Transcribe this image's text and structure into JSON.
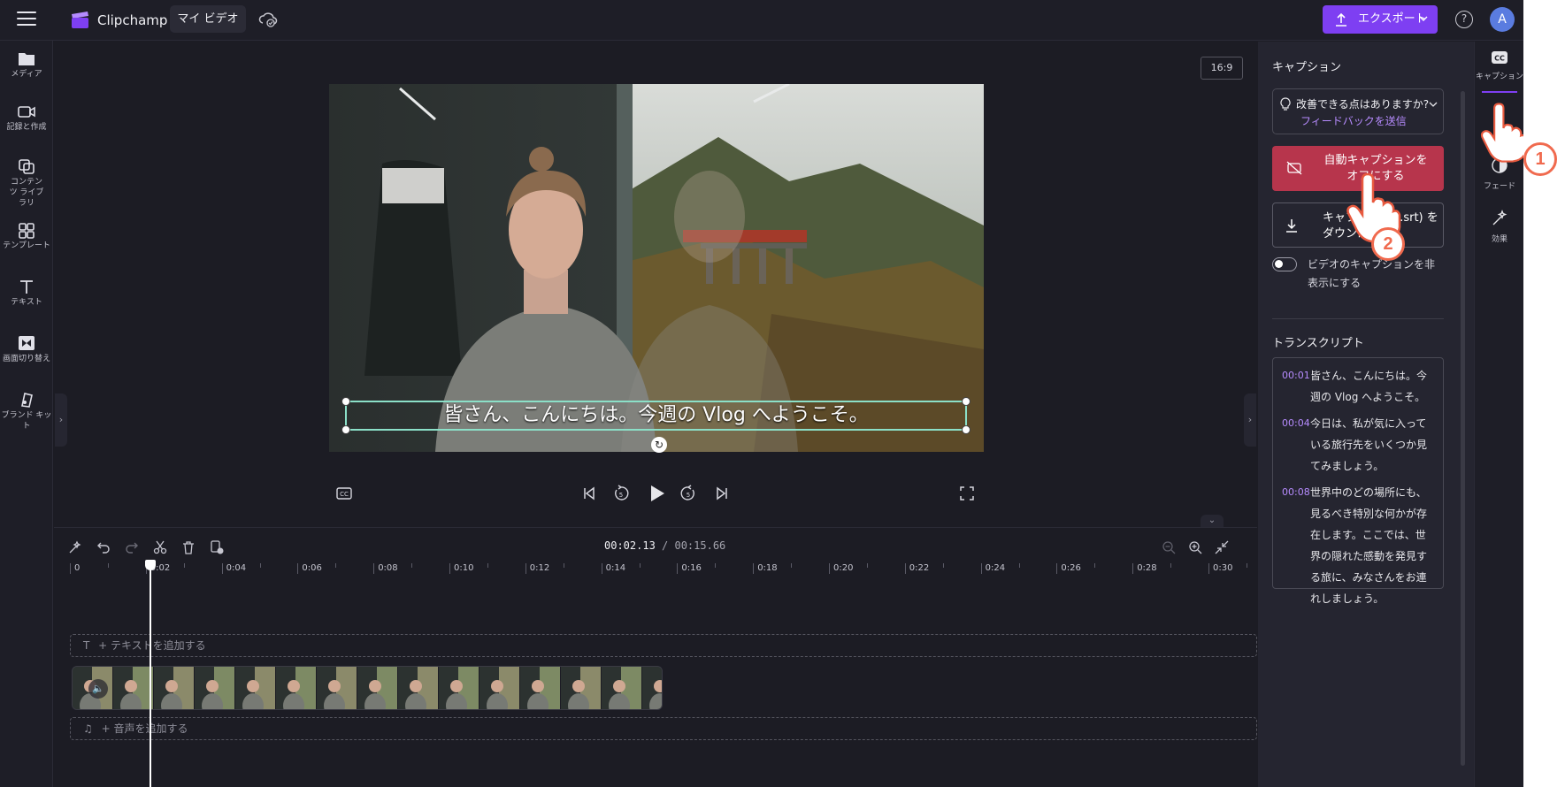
{
  "topbar": {
    "brand": "Clipchamp",
    "my_video": "マイ ビデオ",
    "export_label": "エクスポート",
    "avatar_initial": "A",
    "help_glyph": "?"
  },
  "sidebar": {
    "items": [
      {
        "label": "メディア",
        "icon": "folder-icon"
      },
      {
        "label": "記録と作成",
        "icon": "camera-icon"
      },
      {
        "label": "コンテンツ ライブラリ",
        "icon": "library-icon"
      },
      {
        "label": "テンプレート",
        "icon": "template-icon"
      },
      {
        "label": "テキスト",
        "icon": "text-icon"
      },
      {
        "label": "画面切り替え",
        "icon": "transition-icon"
      },
      {
        "label": "ブランド キット",
        "icon": "brand-icon"
      }
    ]
  },
  "preview": {
    "aspect_ratio": "16:9",
    "caption": "皆さん、こんにちは。今週の Vlog へようこそ。"
  },
  "timeline": {
    "current_time": "00:02.13",
    "separator": " / ",
    "duration": "00:15.66",
    "ticks": [
      "0",
      "0:02",
      "0:04",
      "0:06",
      "0:08",
      "0:10",
      "0:12",
      "0:14",
      "0:16",
      "0:18",
      "0:20",
      "0:22",
      "0:24",
      "0:26",
      "0:28",
      "0:30"
    ],
    "add_text": "+ テキストを追加する",
    "add_audio": "+ 音声を追加する"
  },
  "captions_panel": {
    "title": "キャプション",
    "feedback_question": "改善できる点はありますか?",
    "feedback_link": "フィードバックを送信",
    "auto_caption_off": "自動キャプションを オフにする",
    "download_srt": "キャプション (.srt) をダウンロード",
    "hide_captions": "ビデオのキャプションを非表示にする",
    "transcript_title": "トランスクリプト",
    "transcript": [
      {
        "time": "00:01",
        "text": "皆さん、こんにちは。今週の Vlog へようこそ。"
      },
      {
        "time": "00:04",
        "text": "今日は、私が気に入っている旅行先をいくつか見てみましょう。"
      },
      {
        "time": "00:08",
        "text": "世界中のどの場所にも、見るべき特別な何かが存在します。ここでは、世界の隠れた感動を発見する旅に、みなさんをお連れしましょう。"
      }
    ]
  },
  "right_tools": [
    {
      "label": "キャプション",
      "icon": "cc-icon"
    },
    {
      "label": "フェード",
      "icon": "fade-icon"
    },
    {
      "label": "効果",
      "icon": "effects-icon"
    }
  ],
  "annotations": {
    "step1": "1",
    "step2": "2"
  },
  "colors": {
    "accent": "#7e3ff2",
    "caption_off": "#b7354c",
    "timestamp": "#b78cff",
    "step_badge": "#f06a4e"
  }
}
